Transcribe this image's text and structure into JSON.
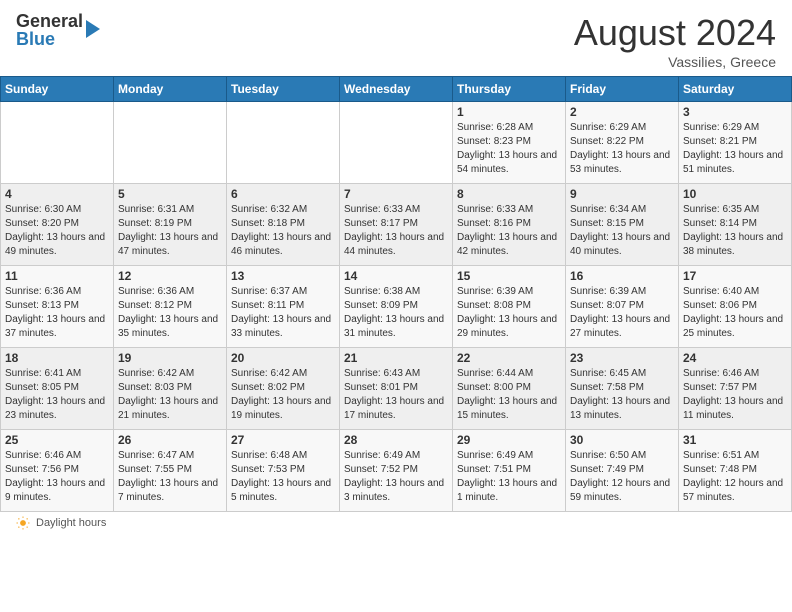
{
  "header": {
    "logo_general": "General",
    "logo_blue": "Blue",
    "month_title": "August 2024",
    "location": "Vassilies, Greece"
  },
  "days_of_week": [
    "Sunday",
    "Monday",
    "Tuesday",
    "Wednesday",
    "Thursday",
    "Friday",
    "Saturday"
  ],
  "footer": {
    "daylight_label": "Daylight hours"
  },
  "weeks": [
    {
      "days": [
        {
          "number": "",
          "info": ""
        },
        {
          "number": "",
          "info": ""
        },
        {
          "number": "",
          "info": ""
        },
        {
          "number": "",
          "info": ""
        },
        {
          "number": "1",
          "info": "Sunrise: 6:28 AM\nSunset: 8:23 PM\nDaylight: 13 hours and 54 minutes."
        },
        {
          "number": "2",
          "info": "Sunrise: 6:29 AM\nSunset: 8:22 PM\nDaylight: 13 hours and 53 minutes."
        },
        {
          "number": "3",
          "info": "Sunrise: 6:29 AM\nSunset: 8:21 PM\nDaylight: 13 hours and 51 minutes."
        }
      ]
    },
    {
      "days": [
        {
          "number": "4",
          "info": "Sunrise: 6:30 AM\nSunset: 8:20 PM\nDaylight: 13 hours and 49 minutes."
        },
        {
          "number": "5",
          "info": "Sunrise: 6:31 AM\nSunset: 8:19 PM\nDaylight: 13 hours and 47 minutes."
        },
        {
          "number": "6",
          "info": "Sunrise: 6:32 AM\nSunset: 8:18 PM\nDaylight: 13 hours and 46 minutes."
        },
        {
          "number": "7",
          "info": "Sunrise: 6:33 AM\nSunset: 8:17 PM\nDaylight: 13 hours and 44 minutes."
        },
        {
          "number": "8",
          "info": "Sunrise: 6:33 AM\nSunset: 8:16 PM\nDaylight: 13 hours and 42 minutes."
        },
        {
          "number": "9",
          "info": "Sunrise: 6:34 AM\nSunset: 8:15 PM\nDaylight: 13 hours and 40 minutes."
        },
        {
          "number": "10",
          "info": "Sunrise: 6:35 AM\nSunset: 8:14 PM\nDaylight: 13 hours and 38 minutes."
        }
      ]
    },
    {
      "days": [
        {
          "number": "11",
          "info": "Sunrise: 6:36 AM\nSunset: 8:13 PM\nDaylight: 13 hours and 37 minutes."
        },
        {
          "number": "12",
          "info": "Sunrise: 6:36 AM\nSunset: 8:12 PM\nDaylight: 13 hours and 35 minutes."
        },
        {
          "number": "13",
          "info": "Sunrise: 6:37 AM\nSunset: 8:11 PM\nDaylight: 13 hours and 33 minutes."
        },
        {
          "number": "14",
          "info": "Sunrise: 6:38 AM\nSunset: 8:09 PM\nDaylight: 13 hours and 31 minutes."
        },
        {
          "number": "15",
          "info": "Sunrise: 6:39 AM\nSunset: 8:08 PM\nDaylight: 13 hours and 29 minutes."
        },
        {
          "number": "16",
          "info": "Sunrise: 6:39 AM\nSunset: 8:07 PM\nDaylight: 13 hours and 27 minutes."
        },
        {
          "number": "17",
          "info": "Sunrise: 6:40 AM\nSunset: 8:06 PM\nDaylight: 13 hours and 25 minutes."
        }
      ]
    },
    {
      "days": [
        {
          "number": "18",
          "info": "Sunrise: 6:41 AM\nSunset: 8:05 PM\nDaylight: 13 hours and 23 minutes."
        },
        {
          "number": "19",
          "info": "Sunrise: 6:42 AM\nSunset: 8:03 PM\nDaylight: 13 hours and 21 minutes."
        },
        {
          "number": "20",
          "info": "Sunrise: 6:42 AM\nSunset: 8:02 PM\nDaylight: 13 hours and 19 minutes."
        },
        {
          "number": "21",
          "info": "Sunrise: 6:43 AM\nSunset: 8:01 PM\nDaylight: 13 hours and 17 minutes."
        },
        {
          "number": "22",
          "info": "Sunrise: 6:44 AM\nSunset: 8:00 PM\nDaylight: 13 hours and 15 minutes."
        },
        {
          "number": "23",
          "info": "Sunrise: 6:45 AM\nSunset: 7:58 PM\nDaylight: 13 hours and 13 minutes."
        },
        {
          "number": "24",
          "info": "Sunrise: 6:46 AM\nSunset: 7:57 PM\nDaylight: 13 hours and 11 minutes."
        }
      ]
    },
    {
      "days": [
        {
          "number": "25",
          "info": "Sunrise: 6:46 AM\nSunset: 7:56 PM\nDaylight: 13 hours and 9 minutes."
        },
        {
          "number": "26",
          "info": "Sunrise: 6:47 AM\nSunset: 7:55 PM\nDaylight: 13 hours and 7 minutes."
        },
        {
          "number": "27",
          "info": "Sunrise: 6:48 AM\nSunset: 7:53 PM\nDaylight: 13 hours and 5 minutes."
        },
        {
          "number": "28",
          "info": "Sunrise: 6:49 AM\nSunset: 7:52 PM\nDaylight: 13 hours and 3 minutes."
        },
        {
          "number": "29",
          "info": "Sunrise: 6:49 AM\nSunset: 7:51 PM\nDaylight: 13 hours and 1 minute."
        },
        {
          "number": "30",
          "info": "Sunrise: 6:50 AM\nSunset: 7:49 PM\nDaylight: 12 hours and 59 minutes."
        },
        {
          "number": "31",
          "info": "Sunrise: 6:51 AM\nSunset: 7:48 PM\nDaylight: 12 hours and 57 minutes."
        }
      ]
    }
  ]
}
